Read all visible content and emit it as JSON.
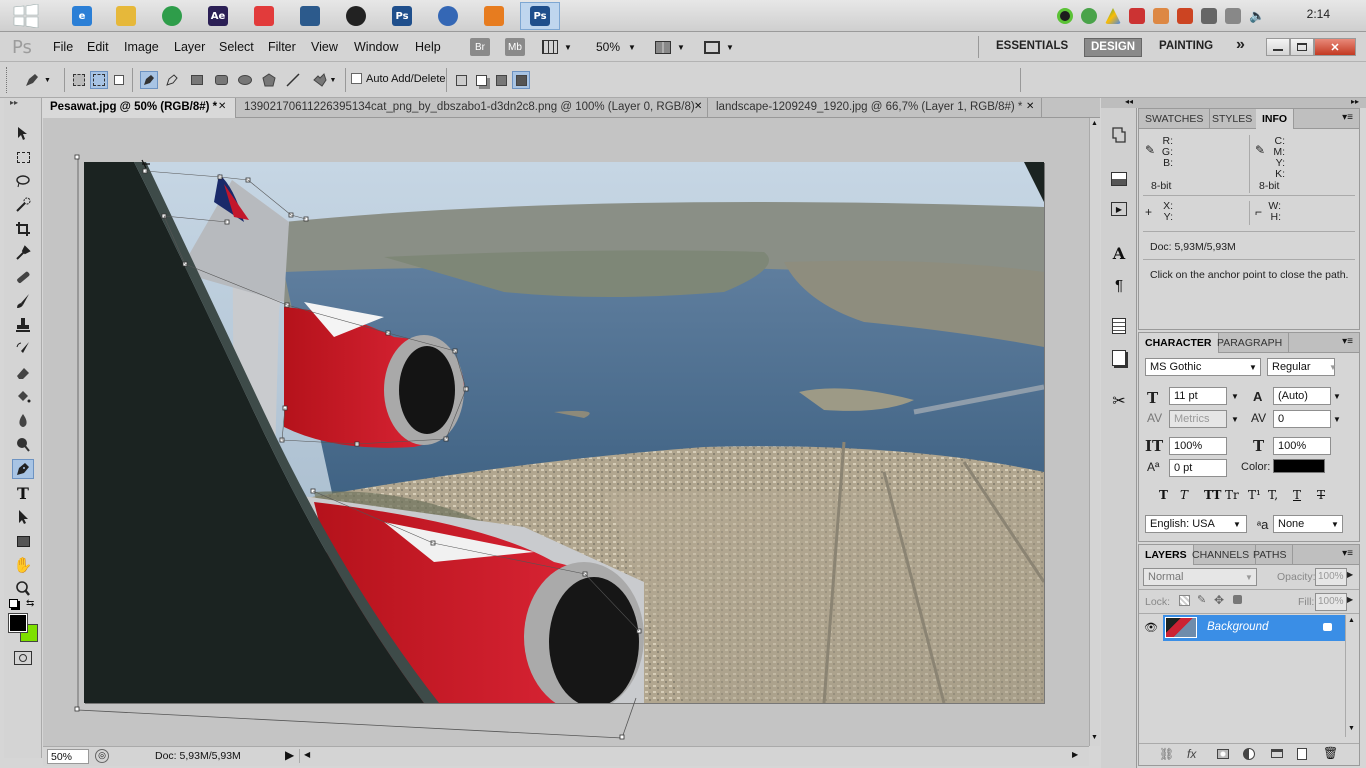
{
  "taskbar": {
    "apps": [
      {
        "name": "ie",
        "label": "e",
        "color": "#2b7fd6"
      },
      {
        "name": "folder",
        "label": "",
        "color": "#e6b83a"
      },
      {
        "name": "chrome",
        "label": "",
        "color": "#2e9d4a"
      },
      {
        "name": "after-effects",
        "label": "Ae",
        "color": "#2b1f55"
      },
      {
        "name": "app-red",
        "label": "",
        "color": "#e23b3b"
      },
      {
        "name": "app-pattern",
        "label": "",
        "color": "#2c5a8c"
      },
      {
        "name": "app-rec",
        "label": "",
        "color": "#222222"
      },
      {
        "name": "photoshop-1",
        "label": "Ps",
        "color": "#1f4f8c"
      },
      {
        "name": "app-globe",
        "label": "",
        "color": "#3467b5"
      },
      {
        "name": "app-orange",
        "label": "",
        "color": "#e77c1f"
      },
      {
        "name": "photoshop-2",
        "label": "Ps",
        "color": "#1f4f8c"
      }
    ],
    "clock": "2:14"
  },
  "menubar": {
    "logo": "Ps",
    "items": [
      "File",
      "Edit",
      "Image",
      "Layer",
      "Select",
      "Filter",
      "View",
      "Window",
      "Help"
    ],
    "br": "Br",
    "mb": "Mb",
    "zoom": "50%",
    "workspaces": [
      "ESSENTIALS",
      "DESIGN",
      "PAINTING"
    ],
    "more": "»"
  },
  "options": {
    "auto_add_delete": "Auto Add/Delete"
  },
  "tabs": [
    {
      "label": "Pesawat.jpg @ 50% (RGB/8#) *",
      "active": true
    },
    {
      "label": "13902170611226395134cat_png_by_dbszabo1-d3dn2c8.png @ 100% (Layer 0, RGB/8)",
      "active": false
    },
    {
      "label": "landscape-1209249_1920.jpg @ 66,7% (Layer 1, RGB/8#) *",
      "active": false
    }
  ],
  "status": {
    "zoom": "50%",
    "doc": "Doc: 5,93M/5,93M"
  },
  "info_panel": {
    "tabs": [
      "SWATCHES",
      "STYLES",
      "INFO"
    ],
    "rgb": "R:\nG:\nB:",
    "cmyk": "C:\nM:\nY:\nK:",
    "bit_left": "8-bit",
    "bit_right": "8-bit",
    "xy": "X:\nY:",
    "wh": "W:\nH:",
    "doc": "Doc: 5,93M/5,93M",
    "hint": "Click on the anchor point to close the path."
  },
  "character_panel": {
    "tabs": [
      "CHARACTER",
      "PARAGRAPH"
    ],
    "font_family": "MS Gothic",
    "font_style": "Regular",
    "size": "11 pt",
    "leading": "(Auto)",
    "kerning": "Metrics",
    "tracking": "0",
    "vscale": "100%",
    "hscale": "100%",
    "baseline": "0 pt",
    "color_label": "Color:",
    "color": "#000000",
    "type_buttons": [
      "T",
      "T",
      "TT",
      "Tr",
      "T¹",
      "T,",
      "T",
      "T"
    ],
    "language": "English: USA",
    "aa_label": "a",
    "aa": "None"
  },
  "layers_panel": {
    "tabs": [
      "LAYERS",
      "CHANNELS",
      "PATHS"
    ],
    "blend": "Normal",
    "opacity_label": "Opacity:",
    "opacity": "100%",
    "lock_label": "Lock:",
    "fill_label": "Fill:",
    "fill": "100%",
    "layer_name": "Background"
  },
  "colors": {
    "foreground": "#000000",
    "background": "#7ee000",
    "accent": "#3a8ee6"
  }
}
